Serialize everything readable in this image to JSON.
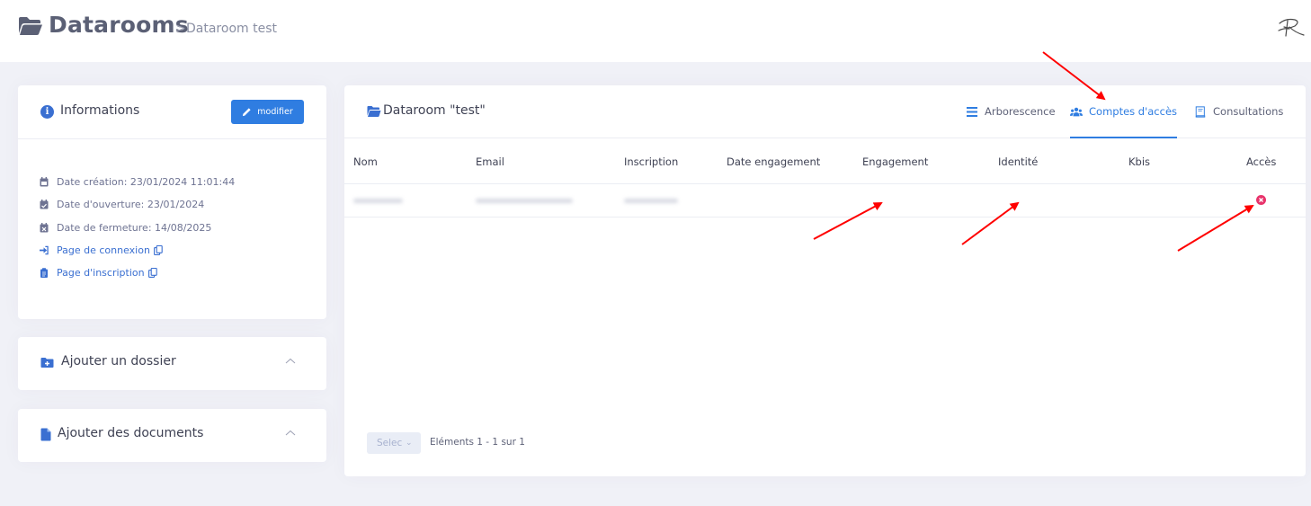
{
  "header": {
    "title": "Datarooms",
    "breadcrumb_sep": ">",
    "breadcrumb_current": "Dataroom test"
  },
  "info_card": {
    "title": "Informations",
    "edit_label": "modifier",
    "rows": [
      {
        "text": "Date création: 23/01/2024 11:01:44",
        "icon": "calendar-icon"
      },
      {
        "text": "Date d'ouverture: 23/01/2024",
        "icon": "calendar-check-icon"
      },
      {
        "text": "Date de fermeture: 14/08/2025",
        "icon": "calendar-x-icon"
      },
      {
        "text": "Page de connexion",
        "icon": "sign-in-icon"
      },
      {
        "text": "Page d'inscription",
        "icon": "clipboard-icon"
      }
    ]
  },
  "add_folder": {
    "title": "Ajouter un dossier"
  },
  "add_documents": {
    "title": "Ajouter des documents"
  },
  "main": {
    "title": "Dataroom \"test\"",
    "tabs": [
      {
        "label": "Arborescence",
        "icon": "list-icon",
        "active": false
      },
      {
        "label": "Comptes d'accès",
        "icon": "users-icon",
        "active": true
      },
      {
        "label": "Consultations",
        "icon": "book-icon",
        "active": false
      }
    ],
    "table": {
      "columns": [
        "Nom",
        "Email",
        "Inscription",
        "Date engagement",
        "Engagement",
        "Identité",
        "Kbis",
        "Accès"
      ]
    },
    "pager": {
      "select_placeholder": "Selec",
      "info": "Eléments 1 - 1 sur 1"
    }
  },
  "colors": {
    "accent": "#2f7de1",
    "danger": "#e8336b",
    "annotation_arrow": "#ff0000"
  }
}
